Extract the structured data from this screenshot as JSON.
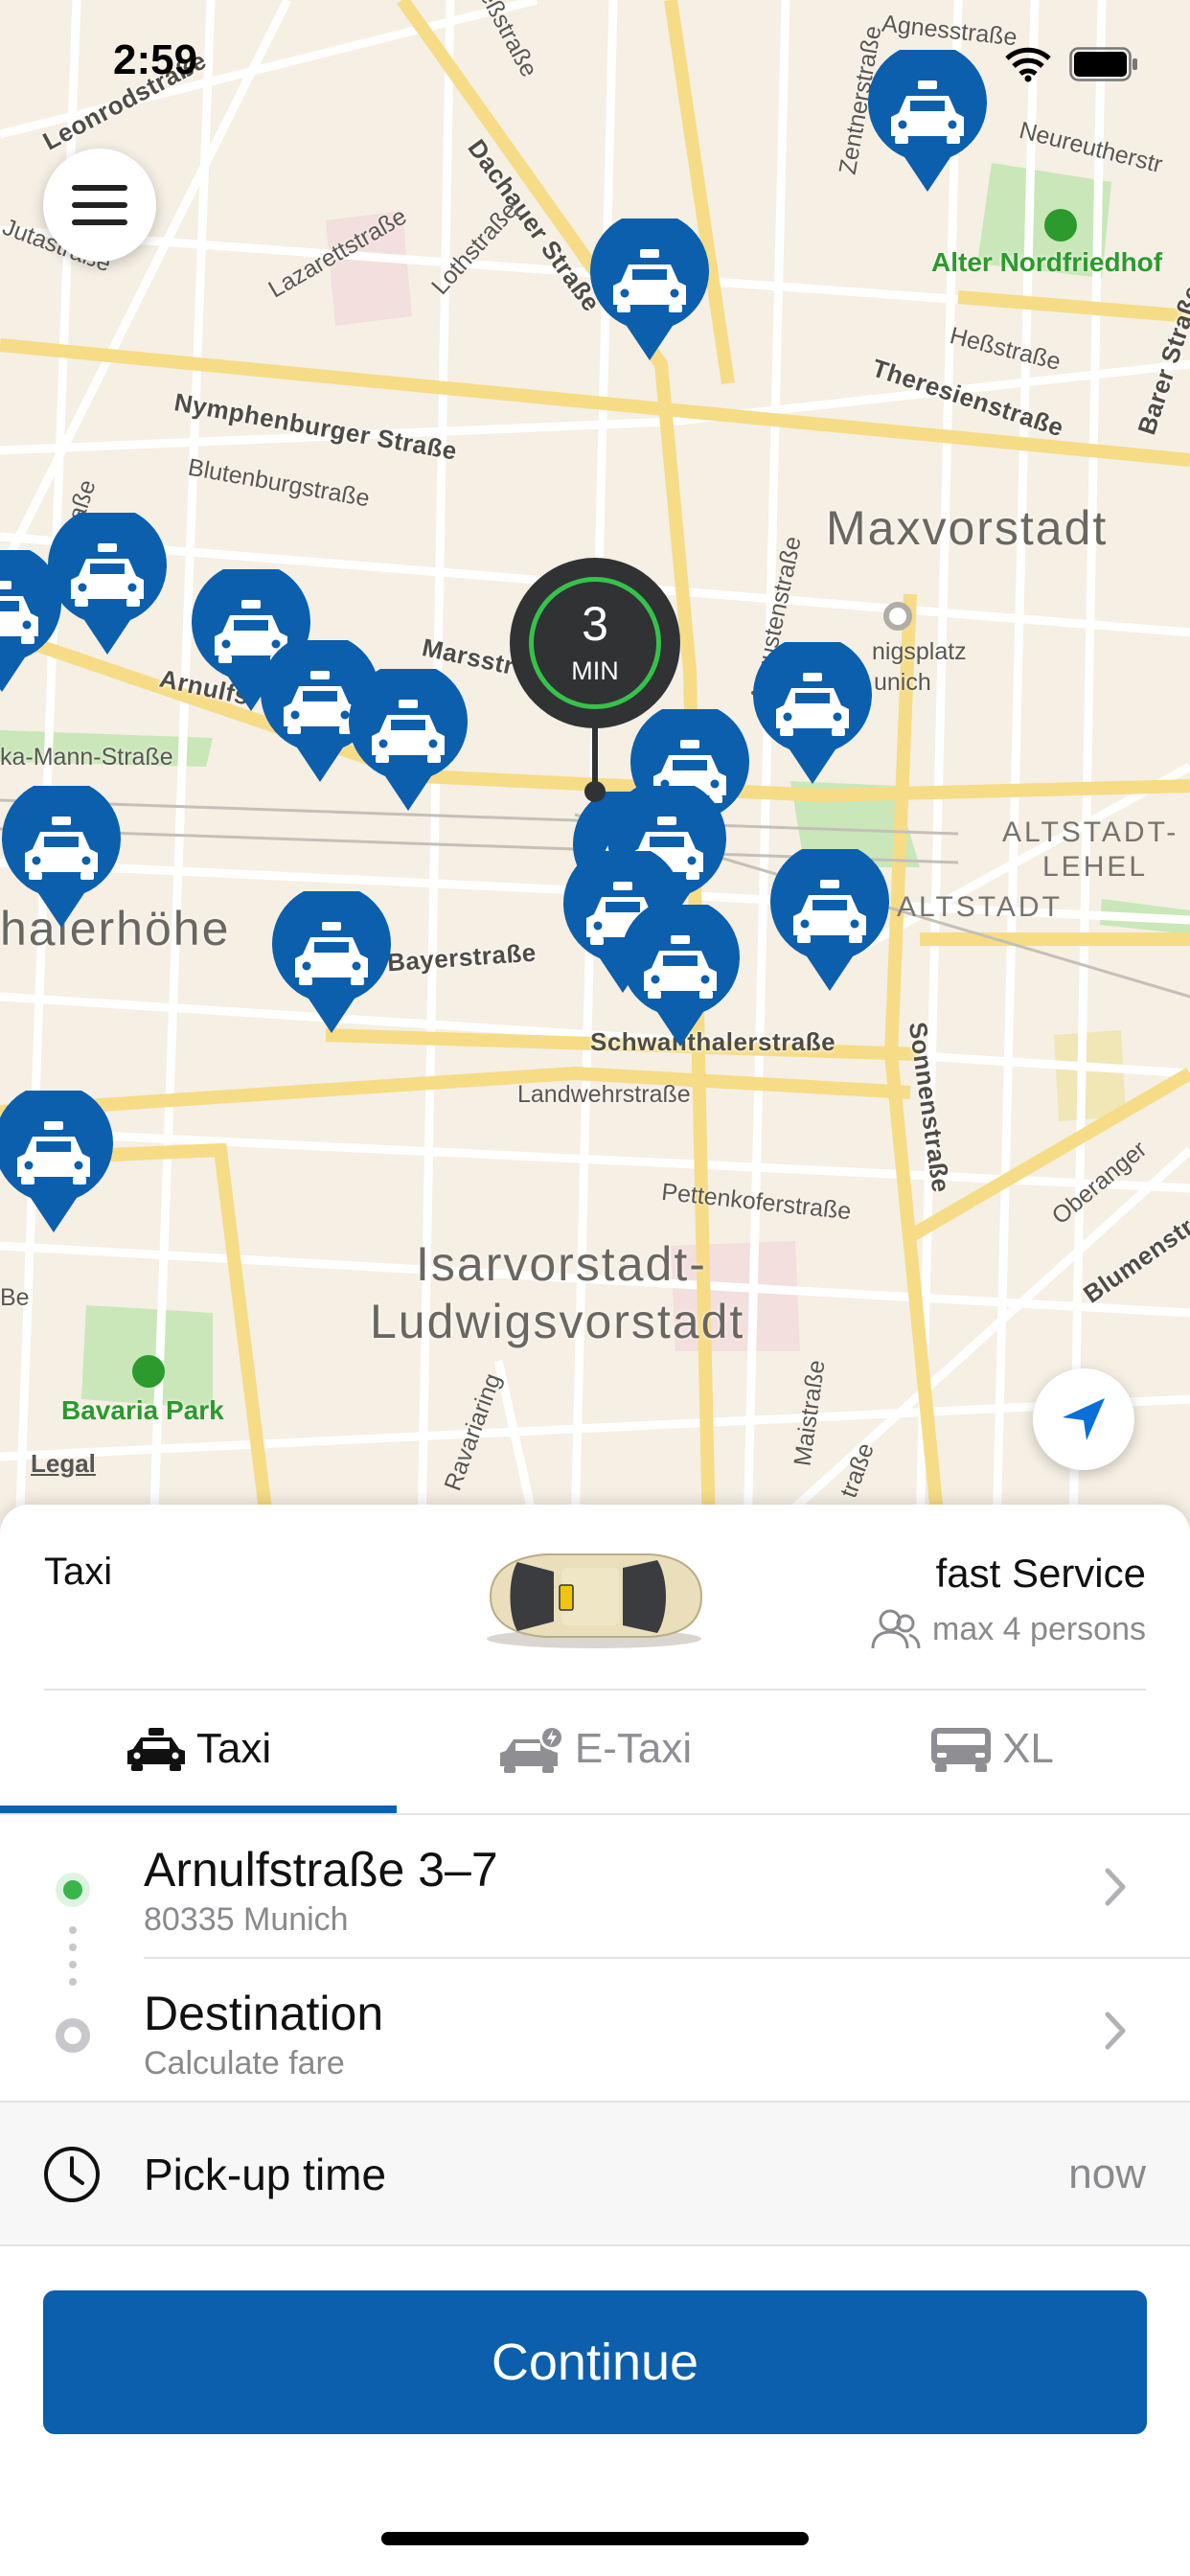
{
  "status_bar": {
    "time": "2:59"
  },
  "map": {
    "districts": [
      "Maxvorstadt",
      "Isarvorstadt-",
      "Ludwigsvorstadt",
      "halerhöhe"
    ],
    "districts_small": [
      "ALTSTADT-",
      "LEHEL",
      "ALTSTADT"
    ],
    "parks": [
      "Alter Nordfriedhof",
      "Bavaria Park"
    ],
    "streets": {
      "leonrod": "Leonrodstraße",
      "dachauer": "Dachauer Straße",
      "nymphenburger": "Nymphenburger Straße",
      "blutenburg": "Blutenburgstraße",
      "lazarett": "Lazarettstraße",
      "loth": "Lothstraße",
      "theresien": "Theresienstraße",
      "hess": "Heßstraße",
      "barer": "Barer Straße",
      "marss": "Marsstr",
      "arnulf": "Arnulfs",
      "augusten": "Augustenstraße",
      "mann": "ka-Mann-Straße",
      "bayer": "Bayerstraße",
      "schwanthaler": "Schwanthalerstraße",
      "landwehr": "Landwehrstraße",
      "pettenkofer": "Pettenkoferstraße",
      "sonnen": "Sonnenstraße",
      "oberanger": "Oberanger",
      "blumen": "Blumenstr",
      "zentner": "Zentnerstraße",
      "agnes": "Agnesstraße",
      "neureuther": "Neureutherstr",
      "koenigsplatz": "nigsplatz",
      "munich": "unich",
      "juta": "Jutastraße",
      "maistr": "Maistraße",
      "ravaria": "Ravariaring",
      "lerkstr": "lerkstraße",
      "estr": "eßstraße",
      "strasse": "traße",
      "tbe": "Be"
    },
    "eta": {
      "value": "3",
      "unit": "MIN"
    },
    "legal_label": "Legal",
    "icons": {
      "menu": "menu-icon",
      "locate": "location-arrow-icon",
      "taxi_pin": "taxi-pin-icon"
    },
    "pin_color": "#0b5fad"
  },
  "service": {
    "name": "Taxi",
    "title": "fast Service",
    "capacity": "max 4 persons"
  },
  "tabs": [
    {
      "label": "Taxi",
      "active": true
    },
    {
      "label": "E-Taxi",
      "active": false
    },
    {
      "label": "XL",
      "active": false
    }
  ],
  "route": {
    "pickup": {
      "title": "Arnulfstraße 3–7",
      "subtitle": "80335 Munich"
    },
    "destination": {
      "title": "Destination",
      "subtitle": "Calculate fare"
    }
  },
  "pickup_time": {
    "label": "Pick-up time",
    "value": "now"
  },
  "continue_label": "Continue",
  "accent_color": "#0b5fad"
}
